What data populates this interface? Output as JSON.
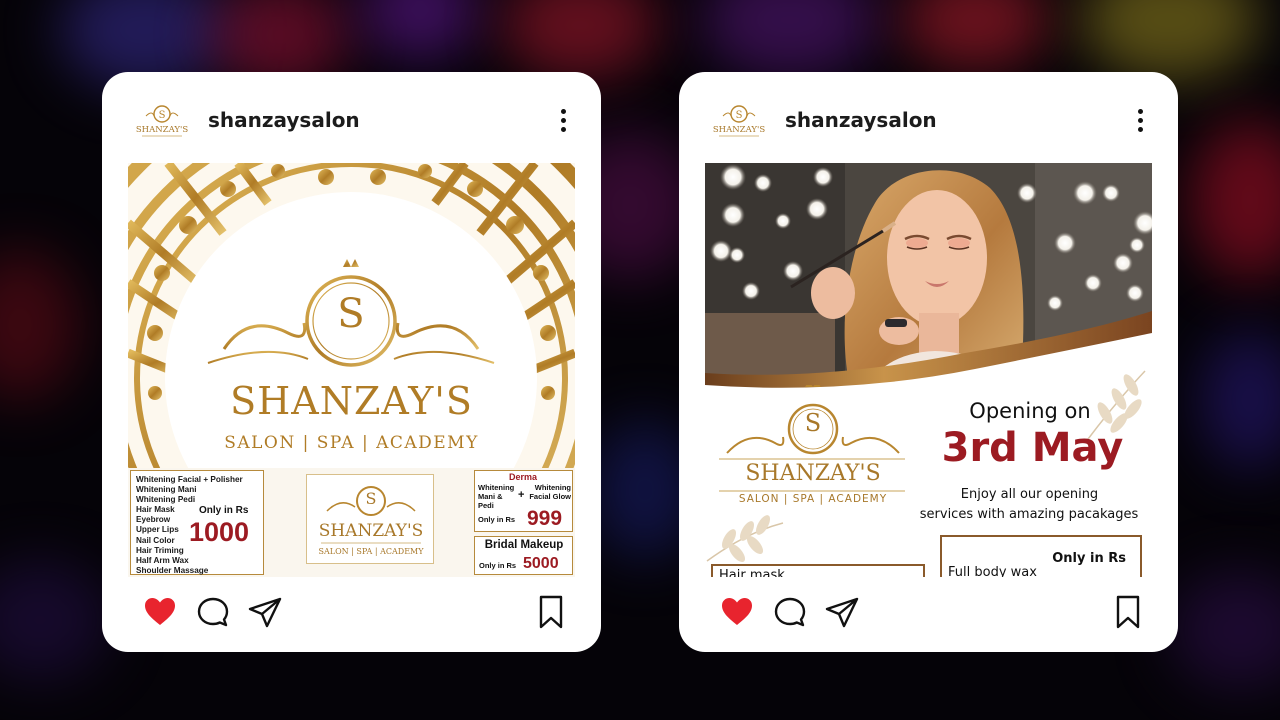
{
  "posts": [
    {
      "username": "shanzaysalon",
      "logo_text": {
        "initial": "S",
        "name": "SHANZAY'S",
        "tagline": "SALON | SPA | ACADEMY"
      },
      "menu_items": [
        "Whitening Facial + Polisher",
        "Whitening Mani",
        "Whitening Pedi",
        "Hair Mask",
        "Eyebrow",
        "Upper Lips",
        "Nail Color",
        "Hair Triming",
        "Half Arm Wax",
        "Shoulder Massage"
      ],
      "offer_main": {
        "label": "Only in Rs",
        "price": "1000"
      },
      "derma": {
        "title": "Derma",
        "col1": "Whitening Mani & Pedi",
        "plus": "+",
        "col2": "Whitening Facial Glow",
        "label": "Only in Rs",
        "price": "999"
      },
      "bridal": {
        "title": "Bridal Makeup",
        "label": "Only in Rs",
        "price": "5000"
      }
    },
    {
      "username": "shanzaysalon",
      "logo_text": {
        "initial": "S",
        "name": "SHANZAY'S",
        "tagline": "SALON | SPA | ACADEMY"
      },
      "opening_label": "Opening on",
      "opening_date": "3rd May",
      "description_line1": "Enjoy all our opening",
      "description_line2": "services with amazing pacakages",
      "service_left": "Hair mask",
      "service_right": "Full body wax",
      "service_right_label": "Only in Rs"
    }
  ],
  "colors": {
    "gold": "#b8862f",
    "maroon": "#9c1b22",
    "like_red": "#e8242e"
  },
  "icons": [
    "heart-icon",
    "comment-icon",
    "share-icon",
    "bookmark-icon",
    "more-options-icon"
  ]
}
